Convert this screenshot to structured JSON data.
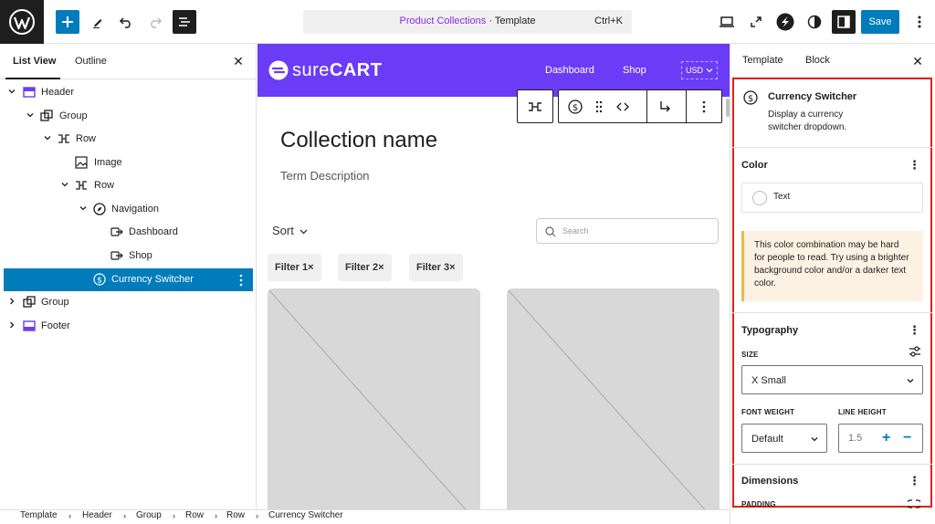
{
  "topbar": {
    "command": {
      "active": "Product Collections",
      "separator": " · ",
      "suffix": "Template",
      "shortcut": "Ctrl+K"
    },
    "save_label": "Save"
  },
  "left": {
    "tabs": [
      "List View",
      "Outline"
    ],
    "tree": [
      {
        "label": "Header",
        "icon": "header-template-icon"
      },
      {
        "label": "Group",
        "icon": "group-icon"
      },
      {
        "label": "Row",
        "icon": "row-icon"
      },
      {
        "label": "Image",
        "icon": "image-icon"
      },
      {
        "label": "Row",
        "icon": "row-icon"
      },
      {
        "label": "Navigation",
        "icon": "navigation-icon"
      },
      {
        "label": "Dashboard",
        "icon": "page-link-icon"
      },
      {
        "label": "Shop",
        "icon": "page-link-icon"
      },
      {
        "label": "Currency Switcher",
        "icon": "currency-icon"
      },
      {
        "label": "Group",
        "icon": "group-icon"
      },
      {
        "label": "Footer",
        "icon": "footer-template-icon"
      }
    ]
  },
  "canvas": {
    "logo_prefix": "sure",
    "logo_suffix": "CART",
    "nav": [
      "Dashboard",
      "Shop"
    ],
    "currency": "USD",
    "collection_title": "Collection name",
    "term": "Term Description",
    "sort": "Sort",
    "search_placeholder": "Search",
    "filters": [
      "Filter 1",
      "Filter 2",
      "Filter 3"
    ],
    "filter_close": "×"
  },
  "right": {
    "tabs": [
      "Template",
      "Block"
    ],
    "block": {
      "title": "Currency Switcher",
      "desc_1": "Display a currency",
      "desc_2": "switcher dropdown."
    },
    "color": {
      "title": "Color",
      "item": "Text"
    },
    "warning": [
      "This color combination may be hard",
      "for people to read. Try using a brighter",
      "background color and/or a darker text",
      "color."
    ],
    "typography": {
      "title": "Typography",
      "size_label": "SIZE",
      "size_value": "X Small",
      "font_weight_label": "FONT WEIGHT",
      "font_weight_value": "Default",
      "line_height_label": "LINE HEIGHT",
      "line_height_value": "1.5",
      "plus": "+",
      "minus": "−"
    },
    "dimensions": {
      "title": "Dimensions",
      "padding_label": "PADDING"
    }
  },
  "breadcrumb": [
    "Template",
    "Header",
    "Group",
    "Row",
    "Row",
    "Currency Switcher"
  ],
  "colors": {
    "accent": "#007cba",
    "brand": "#6a3cf5",
    "highlight": "#e0231c",
    "warning_bg": "#fcf1e3"
  }
}
